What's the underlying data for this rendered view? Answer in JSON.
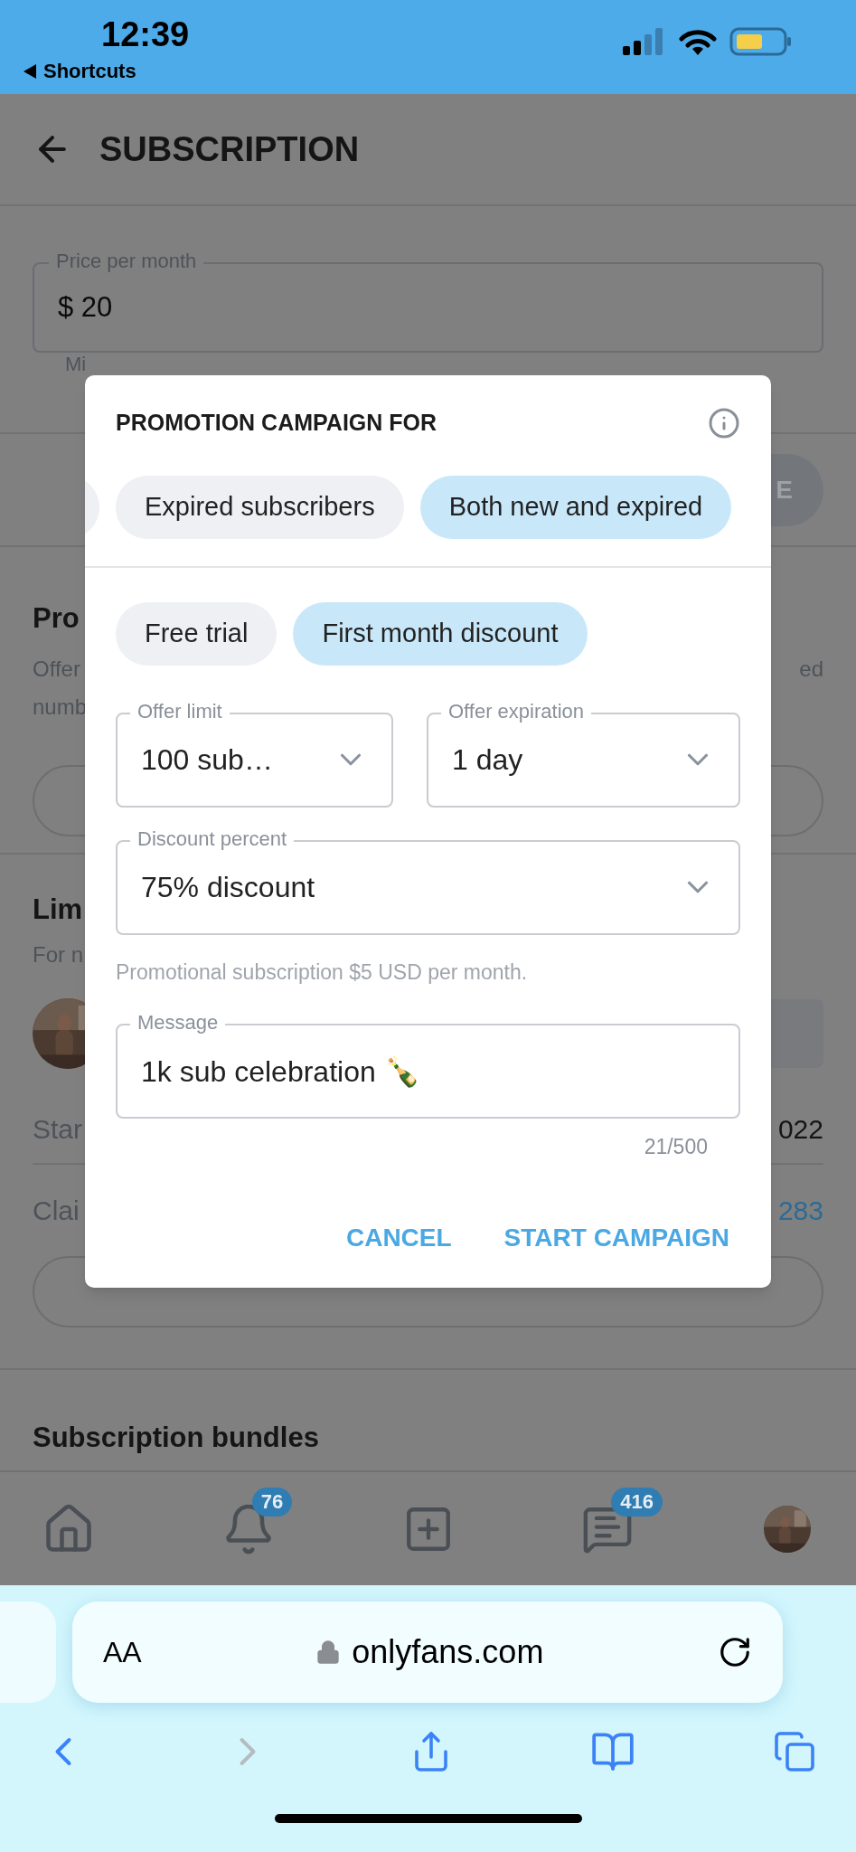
{
  "status_bar": {
    "time": "12:39",
    "back_label": "Shortcuts"
  },
  "header": {
    "title": "SUBSCRIPTION"
  },
  "price_field": {
    "label": "Price per month",
    "value": "$ 20"
  },
  "price_hint": "Mi",
  "save_button_fragment": "E",
  "promotion_section": {
    "heading": "Pro",
    "lines": [
      "Offer",
      "numb"
    ],
    "line_right": "ed"
  },
  "limited_section": {
    "heading": "Lim",
    "subtitle": "For n",
    "started_label": "Star",
    "started_value": "022",
    "claimed_label": "Clai",
    "claimed_value": "283"
  },
  "bundles_heading": "Subscription bundles",
  "bottom_nav": [
    {
      "kind": "home"
    },
    {
      "kind": "bell",
      "badge": "76"
    },
    {
      "kind": "add"
    },
    {
      "kind": "chat",
      "badge": "416"
    },
    {
      "kind": "avatar"
    }
  ],
  "modal": {
    "title": "PROMOTION CAMPAIGN FOR",
    "audience_chips": [
      {
        "label": "Expired subscribers",
        "selected": false
      },
      {
        "label": "Both new and expired",
        "selected": true
      }
    ],
    "offer_types": [
      {
        "label": "Free trial",
        "selected": false
      },
      {
        "label": "First month discount",
        "selected": true
      }
    ],
    "offer_limit": {
      "label": "Offer limit",
      "value": "100 sub…"
    },
    "offer_expiration": {
      "label": "Offer expiration",
      "value": "1 day"
    },
    "discount_percent": {
      "label": "Discount percent",
      "value": "75% discount"
    },
    "hint": "Promotional subscription $5 USD per month.",
    "message": {
      "label": "Message",
      "value": "1k sub celebration 🍾"
    },
    "counter": "21/500",
    "buttons": [
      "CANCEL",
      "START CAMPAIGN"
    ]
  },
  "browser": {
    "text_size_label": "AA",
    "url": "onlyfans.com",
    "toolbar": [
      {
        "kind": "back",
        "disabled": false
      },
      {
        "kind": "forward",
        "disabled": true
      },
      {
        "kind": "share",
        "disabled": false
      },
      {
        "kind": "bookmarks",
        "disabled": false
      },
      {
        "kind": "tabs",
        "disabled": false
      }
    ]
  }
}
